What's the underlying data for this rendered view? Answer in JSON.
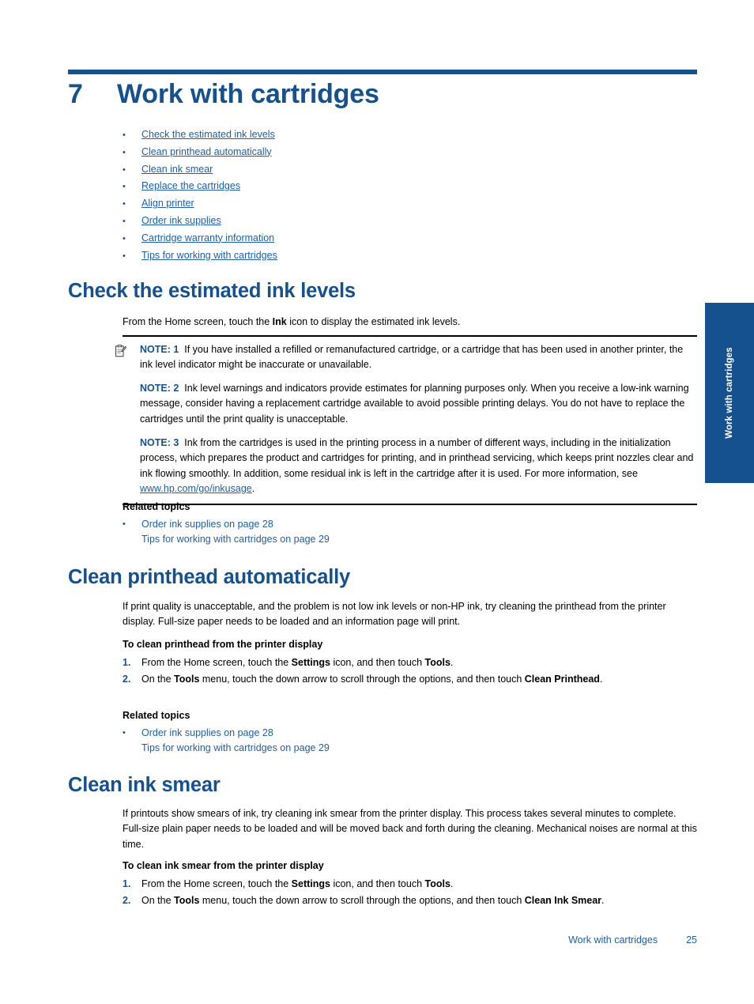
{
  "chapter": {
    "number": "7",
    "title": "Work with cartridges"
  },
  "toc": {
    "bullet": "•",
    "items": [
      {
        "label": "Check the estimated ink levels"
      },
      {
        "label": "Clean printhead automatically"
      },
      {
        "label": "Clean ink smear"
      },
      {
        "label": "Replace the cartridges"
      },
      {
        "label": "Align printer"
      },
      {
        "label": "Order ink supplies"
      },
      {
        "label": "Cartridge warranty information"
      },
      {
        "label": "Tips for working with cartridges"
      }
    ]
  },
  "section1": {
    "heading": "Check the estimated ink levels",
    "intro_pre": "From the Home screen, touch the ",
    "intro_bold": "Ink",
    "intro_post": " icon to display the estimated ink levels.",
    "notes": [
      {
        "label": "NOTE: 1",
        "text": "If you have installed a refilled or remanufactured cartridge, or a cartridge that has been used in another printer, the ink level indicator might be inaccurate or unavailable."
      },
      {
        "label": "NOTE: 2",
        "text": "Ink level warnings and indicators provide estimates for planning purposes only. When you receive a low-ink warning message, consider having a replacement cartridge available to avoid possible printing delays. You do not have to replace the cartridges until the print quality is unacceptable."
      },
      {
        "label": "NOTE: 3",
        "text_pre": "Ink from the cartridges is used in the printing process in a number of different ways, including in the initialization process, which prepares the product and cartridges for printing, and in printhead servicing, which keeps print nozzles clear and ink flowing smoothly. In addition, some residual ink is left in the cartridge after it is used. For more information, see ",
        "link": "www.hp.com/go/inkusage",
        "text_post": "."
      }
    ],
    "related": {
      "title": "Related topics",
      "bullet": "•",
      "links": [
        "Order ink supplies on page 28",
        "Tips for working with cartridges on page 29"
      ]
    }
  },
  "section2": {
    "heading": "Clean printhead automatically",
    "body": "If print quality is unacceptable, and the problem is not low ink levels or non-HP ink, try cleaning the printhead from the printer display. Full-size paper needs to be loaded and an information page will print.",
    "procedure": {
      "title": "To clean printhead from the printer display",
      "steps": [
        {
          "num": "1.",
          "pre": "From the Home screen, touch the ",
          "b1": "Settings",
          "mid": " icon, and then touch ",
          "b2": "Tools",
          "post": "."
        },
        {
          "num": "2.",
          "pre": "On the ",
          "b1": "Tools",
          "mid": " menu, touch the down arrow to scroll through the options, and then touch ",
          "b2": "Clean Printhead",
          "post": "."
        }
      ]
    },
    "related": {
      "title": "Related topics",
      "bullet": "•",
      "links": [
        "Order ink supplies on page 28",
        "Tips for working with cartridges on page 29"
      ]
    }
  },
  "section3": {
    "heading": "Clean ink smear",
    "body": "If printouts show smears of ink, try cleaning ink smear from the printer display. This process takes several minutes to complete. Full-size plain paper needs to be loaded and will be moved back and forth during the cleaning. Mechanical noises are normal at this time.",
    "procedure": {
      "title": "To clean ink smear from the printer display",
      "steps": [
        {
          "num": "1.",
          "pre": "From the Home screen, touch the ",
          "b1": "Settings",
          "mid": " icon, and then touch ",
          "b2": "Tools",
          "post": "."
        },
        {
          "num": "2.",
          "pre": "On the ",
          "b1": "Tools",
          "mid": " menu, touch the down arrow to scroll through the options, and then touch ",
          "b2": "Clean Ink Smear",
          "post": "."
        }
      ]
    }
  },
  "side_tab": {
    "label": "Work with cartridges"
  },
  "footer": {
    "chapter": "Work with cartridges",
    "page": "25"
  },
  "colors": {
    "heading_blue": "#15508F",
    "link_blue": "#1B5FAE",
    "related_link_blue": "#2060A8",
    "rule_black": "#000000"
  }
}
